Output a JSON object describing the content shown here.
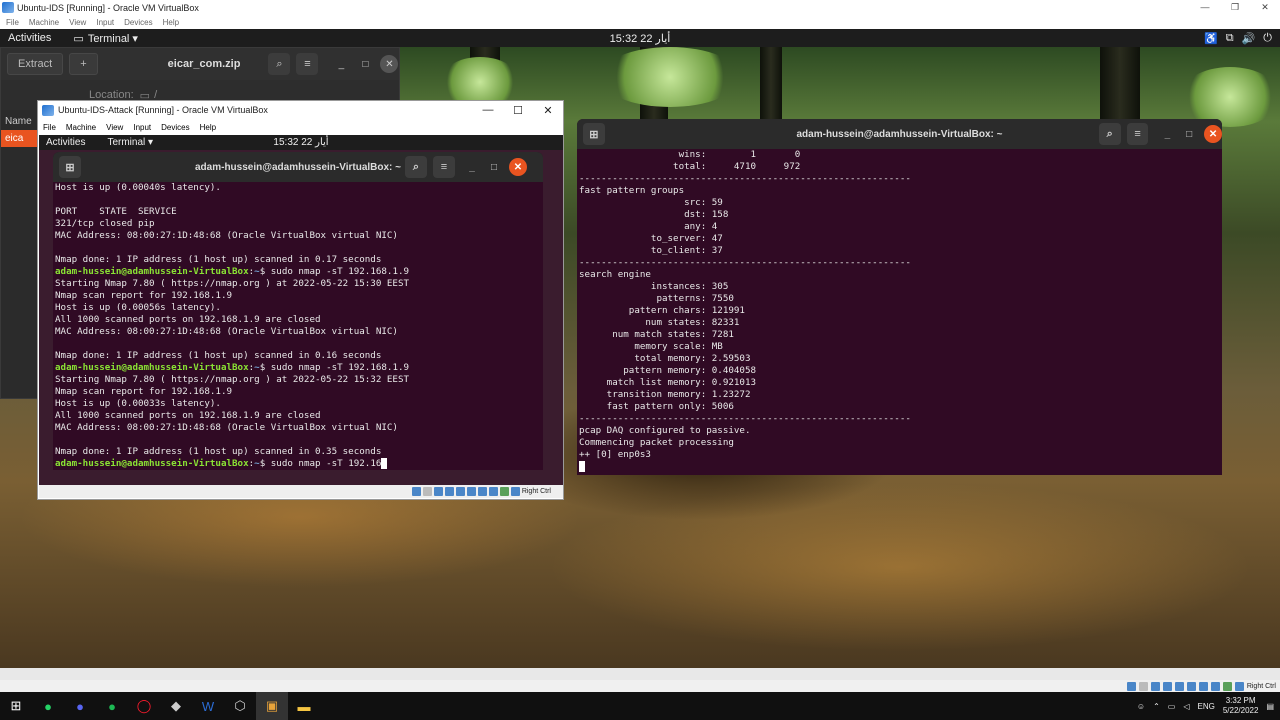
{
  "host": {
    "title": "Ubuntu-IDS [Running] - Oracle VM VirtualBox",
    "menu": [
      "File",
      "Machine",
      "View",
      "Input",
      "Devices",
      "Help"
    ],
    "status_label": "Right Ctrl"
  },
  "topbar": {
    "activities": "Activities",
    "app": "Terminal ▾",
    "clock": "15:32  22 أيار"
  },
  "archive": {
    "extract": "Extract",
    "title": "eicar_com.zip",
    "location_label": "Location:",
    "location": "/",
    "col_name": "Name",
    "item": "eica"
  },
  "vm": {
    "title": "Ubuntu-IDS-Attack [Running] - Oracle VM VirtualBox",
    "menu": [
      "File",
      "Machine",
      "View",
      "Input",
      "Devices",
      "Help"
    ],
    "activities": "Activities",
    "app": "Terminal ▾",
    "clock": "15:32  22 أيار",
    "status_label": "Right Ctrl",
    "term_title": "adam-hussein@adamhussein-VirtualBox: ~"
  },
  "snort": {
    "title": "adam-hussein@adamhussein-VirtualBox: ~"
  },
  "taskbar": {
    "lang": "ENG",
    "time": "3:32 PM",
    "date": "5/22/2022"
  }
}
